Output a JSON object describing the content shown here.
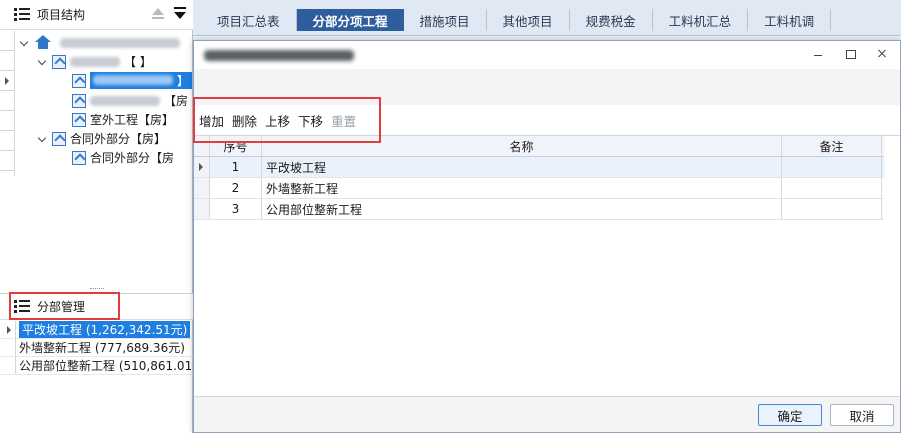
{
  "left_panel": {
    "project_structure_title": "项目结构",
    "tree": {
      "root_label": "",
      "node_level1": "【 】",
      "node_selected": "】",
      "node_blurred": "【房",
      "node_outdoor": "室外工程【房】",
      "node_contract_outside": "合同外部分【房】",
      "node_contract_outside_child": "合同外部分【房"
    },
    "fen_bu_title": "分部管理",
    "fen_bu_items": [
      "平改坡工程 (1,262,342.51元)",
      "外墙整新工程 (777,689.36元)",
      "公用部位整新工程 (510,861.01..."
    ]
  },
  "tabs": [
    "项目汇总表",
    "分部分项工程",
    "措施项目",
    "其他项目",
    "规费税金",
    "工料机汇总",
    "工料机调"
  ],
  "active_tab_index": 1,
  "dialog": {
    "title_suffix": "",
    "toolbar": {
      "add": "增加",
      "delete": "删除",
      "move_up": "上移",
      "move_down": "下移",
      "reset": "重置"
    },
    "grid": {
      "headers": {
        "no": "序号",
        "name": "名称",
        "note": "备注"
      },
      "rows": [
        {
          "no": "1",
          "name": "平改坡工程",
          "note": ""
        },
        {
          "no": "2",
          "name": "外墙整新工程",
          "note": ""
        },
        {
          "no": "3",
          "name": "公用部位整新工程",
          "note": ""
        }
      ]
    },
    "ok_label": "确定",
    "cancel_label": "取消"
  },
  "colors": {
    "accent_tab": "#2e5e9e",
    "selection": "#1e7fe0",
    "highlight_box": "#e23c3c"
  }
}
